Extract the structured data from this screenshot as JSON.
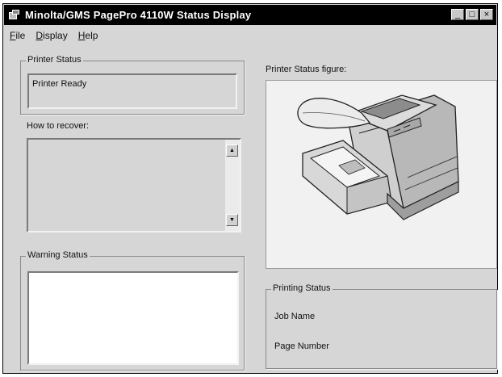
{
  "window": {
    "title": "Minolta/GMS PagePro 4110W Status Display"
  },
  "title_buttons": [
    {
      "name": "minimize-button",
      "glyph": "_"
    },
    {
      "name": "maximize-button",
      "glyph": "□"
    },
    {
      "name": "close-button",
      "glyph": "×"
    }
  ],
  "menu": {
    "items": [
      {
        "label": "File",
        "mnemonic": "F"
      },
      {
        "label": "Display",
        "mnemonic": "D"
      },
      {
        "label": "Help",
        "mnemonic": "H"
      }
    ]
  },
  "printer_status": {
    "group_label": "Printer Status",
    "value": "Printer Ready"
  },
  "recover": {
    "label": "How to recover:",
    "value": ""
  },
  "warning": {
    "group_label": "Warning Status",
    "value": ""
  },
  "figure": {
    "label": "Printer Status figure:",
    "icon": "printer-illustration"
  },
  "printing_status": {
    "group_label": "Printing Status",
    "job_name_label": "Job Name",
    "page_number_label": "Page Number"
  },
  "colors": {
    "window_bg": "#d6d6d6",
    "titlebar_bg": "#000000",
    "figure_bg": "#f1f1f1"
  }
}
